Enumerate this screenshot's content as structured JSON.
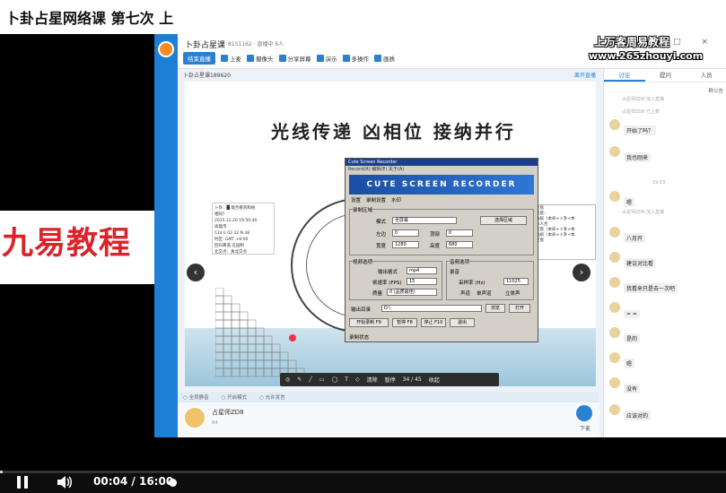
{
  "window": {
    "title": "卜卦占星网络课 第七次 上"
  },
  "banner": {
    "text": "九易教程"
  },
  "watermark": {
    "line1": "上万客周易教程",
    "line2": "www.265zhouyi.com"
  },
  "app": {
    "title": "卜卦占星课",
    "subtitle": "8151162 · 直播中 6人",
    "toolbar": [
      {
        "label": "结束直播",
        "icon": "stop-icon",
        "primary": true
      },
      {
        "label": "上麦",
        "icon": "mic-icon"
      },
      {
        "label": "摄像头",
        "icon": "camera-icon"
      },
      {
        "label": "分享屏幕",
        "icon": "share-screen-icon"
      },
      {
        "label": "演示",
        "icon": "present-icon"
      },
      {
        "label": "多操作",
        "icon": "more-icon"
      },
      {
        "label": "画质",
        "icon": "quality-icon"
      }
    ],
    "course_name": "卜卦占星课189620",
    "right_link": "离开直播"
  },
  "slide": {
    "title": "光线传递 凶相位  接纳并行",
    "infobox": [
      "卜卦：█ 能否看到和他",
      "相同？",
      "2015.12.20 19:50:40",
      "高雄市",
      "114 E 02 22 N 38",
      "时区: GMT +8:00",
      "回归黄道 庄园制",
      "北交点：真北交点"
    ],
    "rightbox": [
      "星盘",
      "星座：",
      "陆居（本命+卜卦+本",
      "本人合",
      "星座（本命+卜卦+本",
      "陆居（本命+卜卦+本",
      "星盘"
    ]
  },
  "recorder": {
    "title": "Cute Screen Recorder",
    "menu": "Record(R)  编辑(E)  关于(A)",
    "banner": "CUTE SCREEN RECORDER",
    "tabs": [
      "设置",
      "录制设置",
      "水印"
    ],
    "region_label": "录制区域",
    "mode_label": "模式",
    "mode_value": "全屏幕",
    "left_label": "左边",
    "left_value": "0",
    "top_label": "顶部",
    "top_value": "0",
    "width_label": "宽度",
    "width_value": "1280",
    "height_label": "高度",
    "height_value": "680",
    "video_label": "视频选项",
    "format_label": "输出格式",
    "format_value": "mp4",
    "fps_label": "帧速率 (FPS)",
    "fps_value": "15",
    "quality_label": "质量",
    "quality_value": "0 (品质最佳)",
    "audio_label": "音频选项",
    "audio_check": "录音",
    "samplerate_label": "采样率 (Hz)",
    "samplerate_value": "11025",
    "channel_label": "声道",
    "mono": "单声道",
    "stereo": "立体声",
    "output_label": "输出目录",
    "output_value": "D:\\",
    "browse": "浏览",
    "open": "打开",
    "select_btn": "选择区域",
    "buttons": [
      "开始录制 F9",
      "暂停 F8",
      "停止 F10",
      "退出"
    ],
    "status": "录制状态"
  },
  "draw_tools": [
    {
      "icon": "pointer-icon"
    },
    {
      "icon": "pen-icon"
    },
    {
      "icon": "line-icon"
    },
    {
      "icon": "rect-icon"
    },
    {
      "icon": "ellipse-icon"
    },
    {
      "icon": "text-icon"
    },
    {
      "icon": "eraser-icon"
    }
  ],
  "draw_actions": {
    "clear": "清除",
    "pause": "暂停",
    "page": "34 / 45",
    "close": "收起"
  },
  "bottom_opts": [
    "全员静音",
    "开启模式",
    "允许发言"
  ],
  "teacher": {
    "name": "占星师ZD8",
    "likes": "84"
  },
  "hand": {
    "label": "下麦"
  },
  "chat": {
    "tabs": [
      "讨论",
      "提问",
      "人员"
    ],
    "notice": "群公告",
    "messages": [
      {
        "user": "",
        "text": "开始了吗？"
      },
      {
        "user": "",
        "text": "我也刚来"
      },
      {
        "user": "",
        "text": "嗯"
      },
      {
        "user": "",
        "text": "八月开"
      },
      {
        "user": "",
        "text": "建议对比看"
      },
      {
        "user": "",
        "text": "我看来只是去一次吧"
      },
      {
        "user": "",
        "text": "= ="
      },
      {
        "user": "",
        "text": "是的"
      },
      {
        "user": "",
        "text": "嗯"
      },
      {
        "user": "",
        "text": "没有"
      },
      {
        "user": "",
        "text": "应该对的"
      }
    ],
    "system": [
      "占星师ZD8 加入直播",
      "占星师ZD8 已上麦",
      "占星师ZD8 加入直播"
    ],
    "time": "19:53"
  },
  "player": {
    "current": "00:04",
    "separator": "/",
    "total": "16:00",
    "progress": 0.004
  }
}
